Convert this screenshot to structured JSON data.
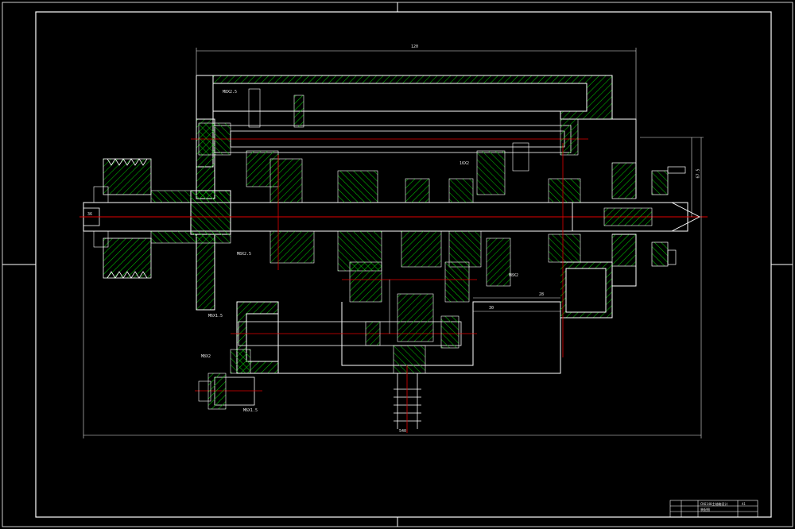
{
  "drawing": {
    "dimensions": {
      "top_width": "120",
      "right_height": "67.5",
      "bottom_length": "540",
      "mid_a": "30",
      "mid_b": "28",
      "mid_c": "36"
    },
    "callouts": {
      "c1": "M8X2.5",
      "c2": "M8X2.5",
      "c3": "16X2",
      "c4": "M8X2",
      "c5": "M6X1.5",
      "c6": "M8X2",
      "c7": "M6X1.5"
    },
    "title_block": {
      "title": "CK6140主轴箱设计",
      "code": "A1",
      "sub": "装配图"
    }
  },
  "colors": {
    "background": "#000000",
    "frame": "#ffffff",
    "outline": "#ffffff",
    "hatch": "#00c000",
    "centerline": "#e00000",
    "dimension": "#e5e5e5",
    "axis_fill": "#0000ff"
  }
}
